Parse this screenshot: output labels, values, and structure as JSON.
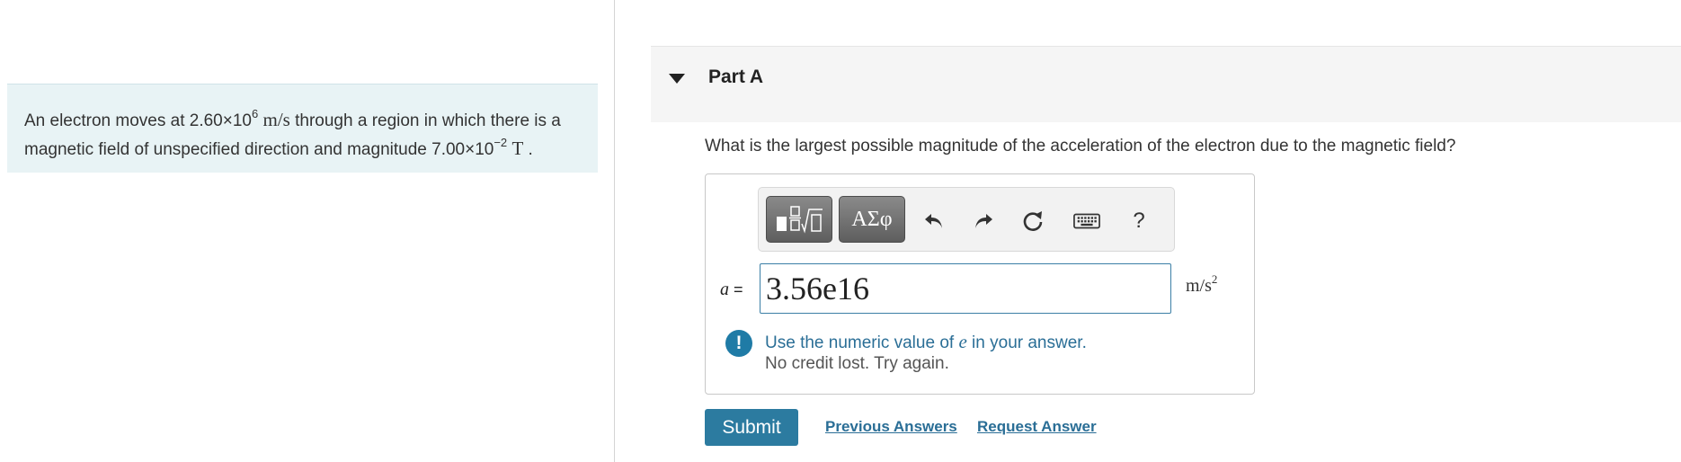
{
  "problem": {
    "text_1": "An electron moves at ",
    "speed_mantissa": "2.60×10",
    "speed_exp": "6",
    "speed_unit": "m/s",
    "text_2": " through a region in which there is a magnetic field of unspecified direction and magnitude ",
    "field_mantissa": "7.00×10",
    "field_exp": "−2",
    "field_unit": "T",
    "text_3": " ."
  },
  "part": {
    "title": "Part A",
    "question": "What is the largest possible magnitude of the acceleration of the electron due to the magnetic field?"
  },
  "toolbar": {
    "symbols_label": "ΑΣφ",
    "help_label": "?"
  },
  "answer": {
    "variable": "a",
    "equals": "=",
    "value": "3.56e16",
    "unit_base": "m/s",
    "unit_exp": "2"
  },
  "feedback": {
    "icon_label": "!",
    "message_pre": "Use the numeric value of ",
    "message_var": "e",
    "message_post": " in your answer.",
    "sub": "No credit lost. Try again."
  },
  "actions": {
    "submit_label": "Submit",
    "previous_answers_label": "Previous Answers",
    "request_answer_label": "Request Answer"
  },
  "colors": {
    "accent": "#2c7ba0",
    "problem_bg": "#e8f3f5",
    "link": "#2a6e96"
  }
}
